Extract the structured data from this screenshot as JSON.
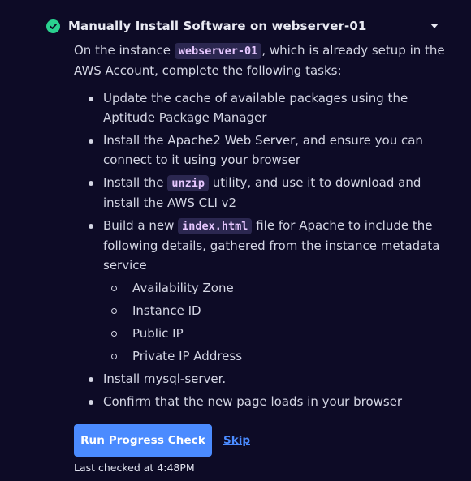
{
  "task": {
    "title": "Manually Install Software on webserver-01",
    "status_icon": "check-circle-icon",
    "expand_icon": "chevron-down-icon"
  },
  "intro": {
    "prefix": "On the instance ",
    "code": "webserver-01",
    "suffix": ", which is already setup in the AWS Account, complete the following tasks:"
  },
  "tasks": [
    {
      "text": "Update the cache of available packages using the Aptitude Package Manager"
    },
    {
      "text": "Install the Apache2 Web Server, and ensure you can connect to it using your browser"
    },
    {
      "prefix": "Install the ",
      "code": "unzip",
      "suffix": " utility, and use it to download and install the AWS CLI v2"
    },
    {
      "prefix": "Build a new ",
      "code": "index.html",
      "suffix": " file for Apache to include the following details, gathered from the instance metadata service",
      "subitems": [
        "Availability Zone",
        "Instance ID",
        "Public IP",
        "Private IP Address"
      ]
    },
    {
      "text": "Install mysql-server."
    },
    {
      "text": "Confirm that the new page loads in your browser"
    }
  ],
  "actions": {
    "run_label": "Run Progress Check",
    "skip_label": "Skip",
    "last_checked": "Last checked at 4:48PM"
  },
  "colors": {
    "background": "#0d0b26",
    "success": "#2ad18f",
    "accent": "#4b8bff",
    "code_text": "#e6c7ff",
    "code_bg": "#2b2750"
  }
}
